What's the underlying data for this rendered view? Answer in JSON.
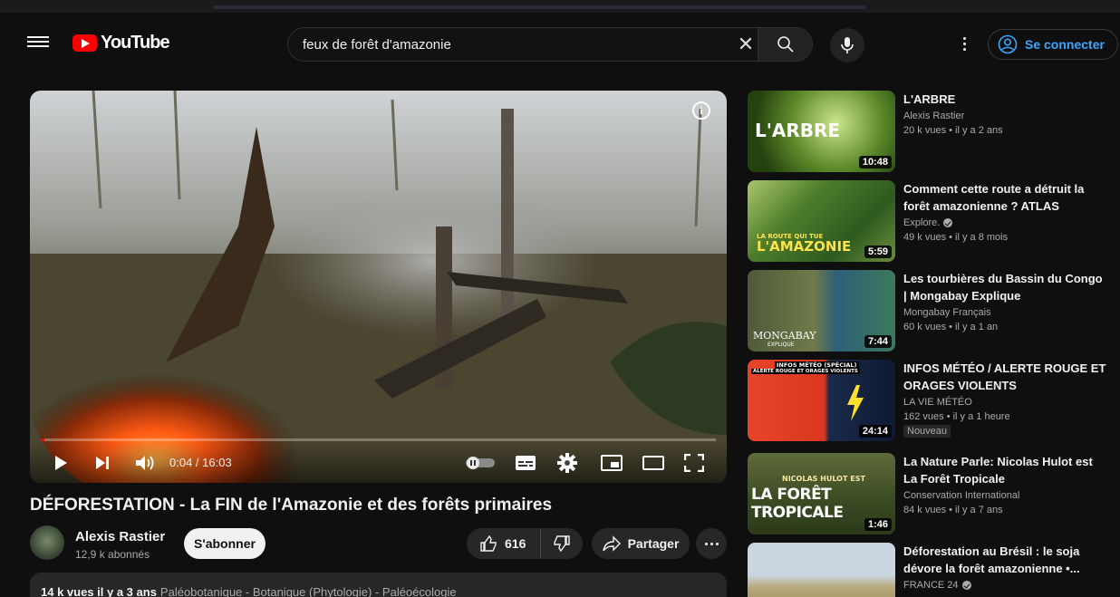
{
  "masthead": {
    "logo_text": "YouTube",
    "search_value": "feux de forêt d'amazonie",
    "signin_label": "Se connecter"
  },
  "player": {
    "time_display": "0:04 / 16:03",
    "progress_fraction": 0.004
  },
  "video": {
    "title": "DÉFORESTATION - La FIN de l'Amazonie et des forêts primaires",
    "channel": "Alexis Rastier",
    "subscribers": "12,9 k abonnés",
    "subscribe_label": "S'abonner",
    "likes": "616",
    "share_label": "Partager",
    "views_date": "14 k vues  il y a 3 ans",
    "tags": "Paléobotanique - Botanique (Phytologie) - Paléoécologie"
  },
  "related": [
    {
      "title": "L'ARBRE",
      "channel": "Alexis Rastier",
      "verified": false,
      "stats": "20 k vues • il y a 2 ans",
      "duration": "10:48",
      "thumb_text": "L'ARBRE"
    },
    {
      "title": "Comment cette route a détruit la forêt amazonienne ? ATLAS",
      "channel": "Explore.",
      "verified": true,
      "stats": "49 k vues • il y a 8 mois",
      "duration": "5:59",
      "thumb_text": "L'AMAZONIE",
      "thumb_text2": "LA ROUTE QUI TUE"
    },
    {
      "title": "Les tourbières du Bassin du Congo | Mongabay Explique",
      "channel": "Mongabay Français",
      "verified": false,
      "stats": "60 k vues • il y a 1 an",
      "duration": "7:44",
      "thumb_text": "MONGABAY",
      "thumb_text2": "EXPLIQUE"
    },
    {
      "title": "INFOS MÉTÉO / ALERTE ROUGE ET ORAGES VIOLENTS",
      "channel": "LA VIE MÉTÉO",
      "verified": false,
      "stats": "162 vues • il y a 1 heure",
      "badge": "Nouveau",
      "duration": "24:14",
      "thumb_text": "INFOS MÉTÉO (SPÉCIAL)",
      "thumb_text2": "ALERTE ROUGE ET ORAGES VIOLENTS"
    },
    {
      "title": "La Nature Parle: Nicolas Hulot est La Forêt Tropicale",
      "channel": "Conservation International",
      "verified": false,
      "stats": "84 k vues • il y a 7 ans",
      "duration": "1:46",
      "thumb_text": "LA FORÊT TROPICALE",
      "thumb_text2": "NICOLAS HULOT EST"
    },
    {
      "title": "Déforestation au Brésil : le soja dévore la forêt amazonienne •...",
      "channel": "FRANCE 24",
      "verified": true,
      "stats": "",
      "duration": "",
      "thumb_text": ""
    }
  ],
  "colors": {
    "accent_red": "#ff0000",
    "link_blue": "#3ea6ff",
    "background": "#0f0f0f",
    "chip": "#272727"
  },
  "icons": [
    "menu-icon",
    "youtube-logo-icon",
    "clear-icon",
    "search-icon",
    "mic-icon",
    "more-vert-icon",
    "account-icon",
    "info-icon",
    "play-icon",
    "next-icon",
    "volume-icon",
    "autoplay-toggle",
    "subtitles-icon",
    "settings-icon",
    "miniplayer-icon",
    "theater-icon",
    "fullscreen-icon",
    "like-icon",
    "dislike-icon",
    "share-icon",
    "more-horiz-icon",
    "verified-icon"
  ]
}
